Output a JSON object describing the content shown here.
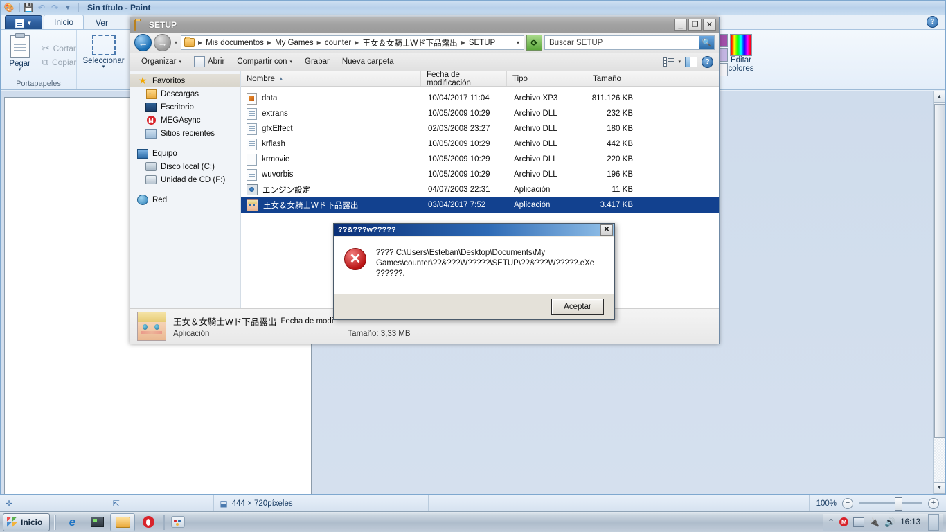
{
  "paint": {
    "title": "Sin título - Paint",
    "quick_access": [
      "paint-palette-icon",
      "save-icon",
      "undo-icon",
      "redo-icon",
      "customize-icon"
    ],
    "menu_button_label": "",
    "tabs": [
      {
        "label": "Inicio",
        "active": true
      },
      {
        "label": "Ver",
        "active": false
      }
    ],
    "help_label": "?",
    "groups": [
      {
        "name": "Portapapeles",
        "big_button": {
          "label": "Pegar",
          "arrow": "▾"
        },
        "small_buttons": [
          {
            "label": "Cortar",
            "icon": "scissors-icon"
          },
          {
            "label": "Copiar",
            "icon": "copy-icon"
          }
        ]
      },
      {
        "name": "",
        "big_button": {
          "label": "Seleccionar",
          "arrow": "▾"
        }
      }
    ],
    "colors_group": {
      "edit_colors_line1": "Editar",
      "edit_colors_line2": "colores",
      "swatches": [
        "#a150a8",
        "#c3b4e2",
        "#f2f2f6"
      ]
    },
    "statusbar": {
      "cursor_cell": "",
      "selection_cell": "",
      "image_size": "444 × 720píxeles",
      "zoom_level": "100%",
      "zoom_out": "−",
      "zoom_in": "+"
    }
  },
  "explorer": {
    "title": "SETUP",
    "window_buttons": {
      "minimize": "_",
      "maximize": "❐",
      "close": "✕"
    },
    "nav": {
      "back": "←",
      "forward": "→",
      "history_caret": "▾",
      "breadcrumbs": [
        "Mis documentos",
        "My Games",
        "counter",
        "王女＆女騎士Wド下品露出",
        "SETUP"
      ],
      "breadcrumb_caret": "▾",
      "refresh": "⟳"
    },
    "search": {
      "placeholder": "Buscar SETUP",
      "value": "Buscar SETUP",
      "icon": "search-icon"
    },
    "toolbar": {
      "organize": "Organizar",
      "open": "Abrir",
      "share_with": "Compartir con",
      "burn": "Grabar",
      "new_folder": "Nueva carpeta",
      "caret": "▾",
      "view_icon": "view-list-icon",
      "preview_pane_icon": "preview-pane-icon",
      "help_icon": "help-icon"
    },
    "nav_pane": [
      {
        "label": "Favoritos",
        "icon": "star-icon",
        "level": 0,
        "selected": true
      },
      {
        "label": "Descargas",
        "icon": "downloads-icon",
        "level": 1,
        "selected": false
      },
      {
        "label": "Escritorio",
        "icon": "desktop-icon",
        "level": 1,
        "selected": false
      },
      {
        "label": "MEGAsync",
        "icon": "mega-icon",
        "level": 1,
        "selected": false
      },
      {
        "label": "Sitios recientes",
        "icon": "recent-places-icon",
        "level": 1,
        "selected": false
      },
      {
        "label": "Equipo",
        "icon": "computer-icon",
        "level": 0,
        "selected": false
      },
      {
        "label": "Disco local (C:)",
        "icon": "hard-disk-icon",
        "level": 1,
        "selected": false
      },
      {
        "label": "Unidad de CD (F:)",
        "icon": "cd-drive-icon",
        "level": 1,
        "selected": false
      },
      {
        "label": "Red",
        "icon": "network-icon",
        "level": 0,
        "selected": false
      }
    ],
    "columns": [
      {
        "label": "Nombre",
        "sorted": true,
        "sort_arrow": "▲"
      },
      {
        "label": "Fecha de modificación",
        "sorted": false
      },
      {
        "label": "Tipo",
        "sorted": false
      },
      {
        "label": "Tamaño",
        "sorted": false
      }
    ],
    "files": [
      {
        "name": "data",
        "modified": "10/04/2017 11:04",
        "type": "Archivo XP3",
        "size": "811.126 KB",
        "icon": "xp3-file-icon",
        "selected": false
      },
      {
        "name": "extrans",
        "modified": "10/05/2009 10:29",
        "type": "Archivo DLL",
        "size": "232 KB",
        "icon": "dll-file-icon",
        "selected": false
      },
      {
        "name": "gfxEffect",
        "modified": "02/03/2008 23:27",
        "type": "Archivo DLL",
        "size": "180 KB",
        "icon": "dll-file-icon",
        "selected": false
      },
      {
        "name": "krflash",
        "modified": "10/05/2009 10:29",
        "type": "Archivo DLL",
        "size": "442 KB",
        "icon": "dll-file-icon",
        "selected": false
      },
      {
        "name": "krmovie",
        "modified": "10/05/2009 10:29",
        "type": "Archivo DLL",
        "size": "220 KB",
        "icon": "dll-file-icon",
        "selected": false
      },
      {
        "name": "wuvorbis",
        "modified": "10/05/2009 10:29",
        "type": "Archivo DLL",
        "size": "196 KB",
        "icon": "dll-file-icon",
        "selected": false
      },
      {
        "name": "エンジン設定",
        "modified": "04/07/2003 22:31",
        "type": "Aplicación",
        "size": "11 KB",
        "icon": "gear-app-icon",
        "selected": false
      },
      {
        "name": "王女＆女騎士Wド下品露出",
        "modified": "03/04/2017 7:52",
        "type": "Aplicación",
        "size": "3.417 KB",
        "icon": "anime-app-icon",
        "selected": true
      }
    ],
    "details_pane": {
      "name": "王女＆女騎士Wド下品露出",
      "modified_label": "Fecha de modi",
      "type": "Aplicación",
      "size": "Tamaño: 3,33 MB",
      "thumbnail": "anime-character-thumbnail"
    }
  },
  "dialog": {
    "title": "??&???w?????",
    "close_label": "✕",
    "icon": "error-icon",
    "message": "???? C:\\Users\\Esteban\\Desktop\\Documents\\My Games\\counter\\??&???W?????\\SETUP\\??&???W?????.eXe ??????.",
    "ok_button": "Aceptar"
  },
  "taskbar": {
    "start_label": "Inicio",
    "apps": [
      {
        "name": "internet-explorer",
        "icon": "ie-icon",
        "active": false
      },
      {
        "name": "media-player",
        "icon": "projector-icon",
        "active": false
      },
      {
        "name": "windows-explorer",
        "icon": "folder-icon",
        "active": true
      },
      {
        "name": "opera",
        "icon": "opera-icon",
        "active": false
      },
      {
        "name": "paint",
        "icon": "paint-icon",
        "active": false
      }
    ],
    "tray": {
      "expand": "⌃",
      "mega": "M",
      "network": "network-icon",
      "plug": "plug-icon",
      "volume": "volume-icon",
      "clock": "16:13"
    }
  }
}
